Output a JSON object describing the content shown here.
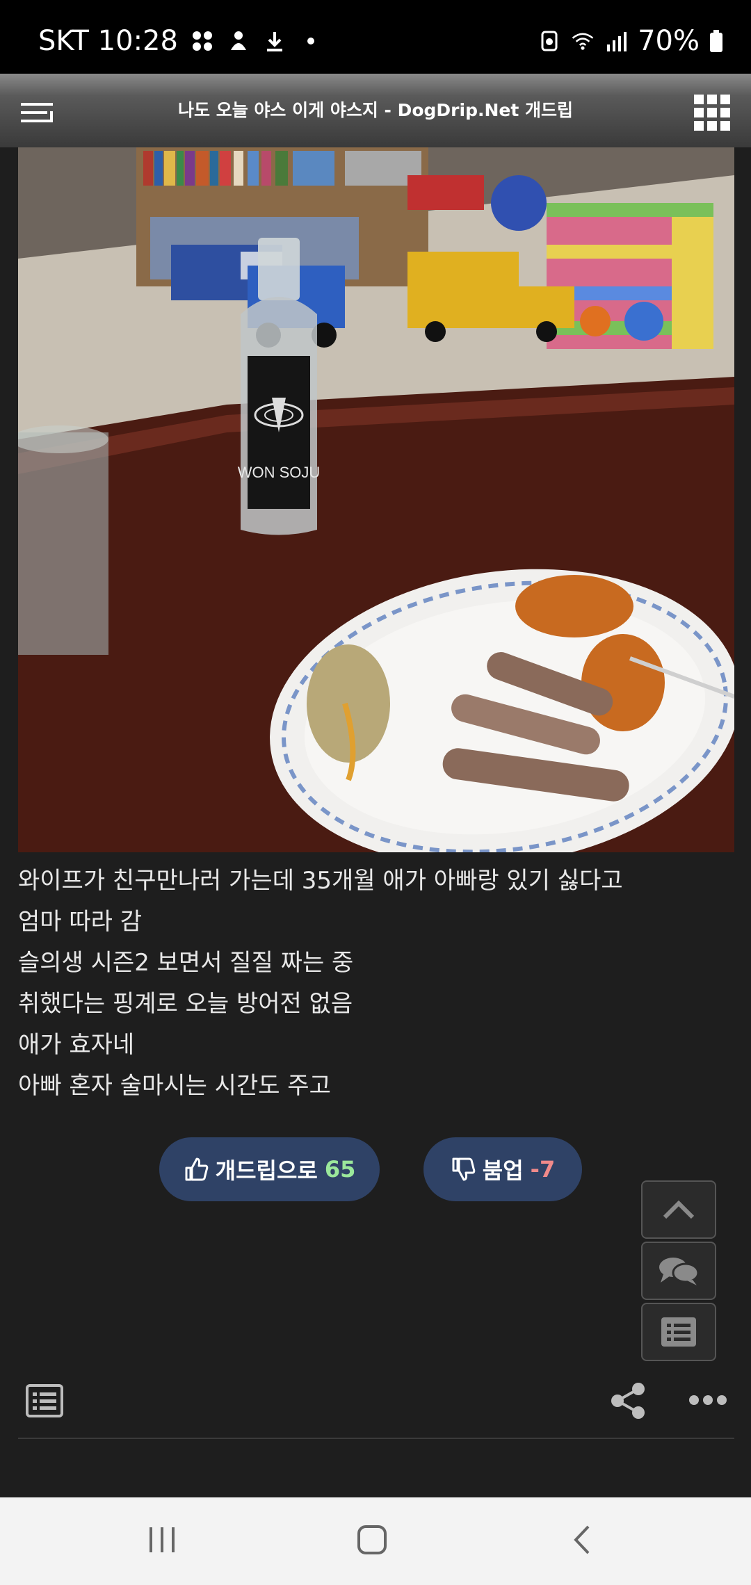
{
  "status_bar": {
    "carrier_time": "SKT 10:28",
    "battery": "70%",
    "icons": [
      "app-grid-icon",
      "notification-icon",
      "download-icon",
      "dot-icon",
      "recycle-icon",
      "wifi-icon",
      "signal-icon",
      "battery-icon"
    ]
  },
  "title_bar": {
    "title": "나도 오늘 야스 이게 야스지 - DogDrip.Net 개드립",
    "left_icon": "menu-icon",
    "right_icon": "grid-menu-icon"
  },
  "photo": {
    "bottle_label": "WON SOJU"
  },
  "post": {
    "lines": [
      "와이프가 친구만나러 가는데 35개월 애가 아빠랑 있기 싫다고",
      "엄마 따라 감",
      "슬의생 시즌2 보면서 질질 짜는 중",
      "취했다는 핑계로 오늘 방어전 없음",
      "애가 효자네",
      "아빠 혼자 술마시는 시간도 주고"
    ]
  },
  "votes": {
    "up_label": "개드립으로",
    "up_count": "65",
    "down_label": "붐업",
    "down_count": "-7"
  },
  "colors": {
    "background": "#1e1e1e",
    "vote_button": "#2f4266",
    "up_count": "#9be89b",
    "down_count": "#f08a8a"
  }
}
